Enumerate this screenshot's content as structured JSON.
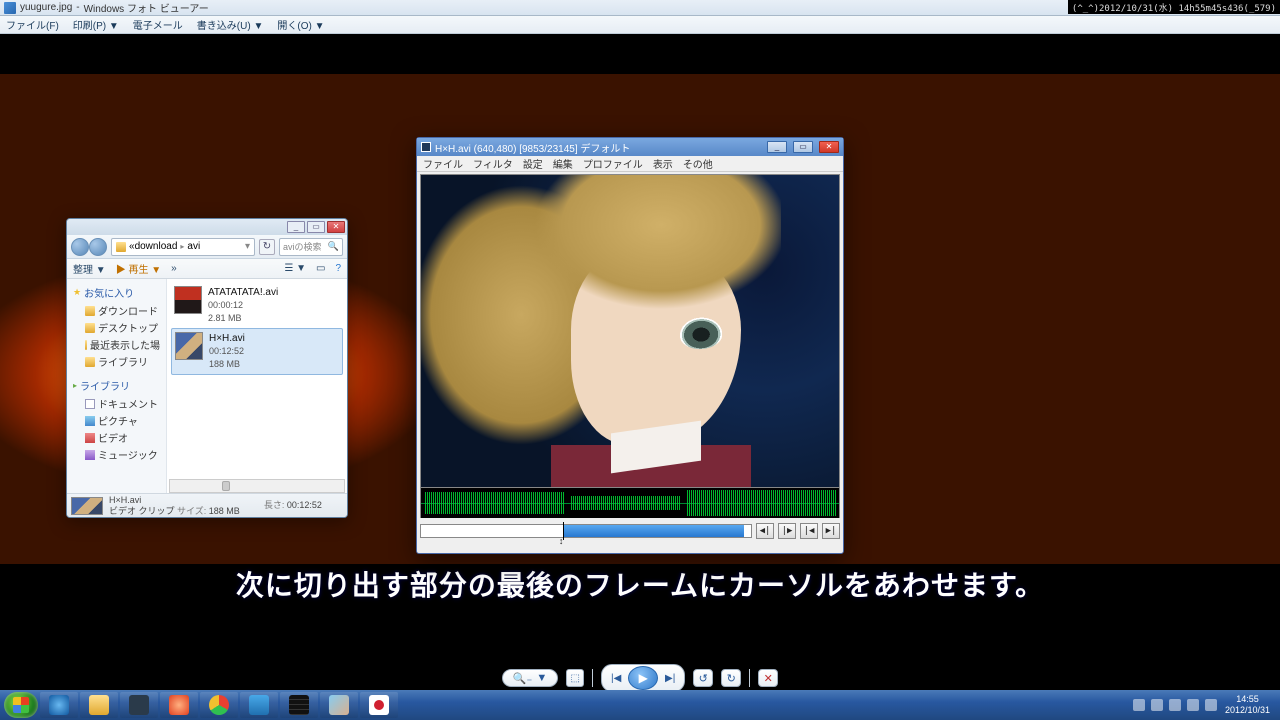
{
  "photoViewer": {
    "fileName": "yuugure.jpg",
    "appName": "Windows フォト ビューアー",
    "titleSep": " - ",
    "menu": {
      "file": "ファイル(F)",
      "print": "印刷(P)  ▼",
      "email": "電子メール",
      "burn": "書き込み(U)  ▼",
      "open": "開く(O)  ▼"
    },
    "controls": {
      "zoomOut": "🔍₋",
      "zoomDown": "▼",
      "fit": "⬚",
      "prev": "|◀",
      "play": "▶",
      "next": "▶|",
      "rotL": "↺",
      "rotR": "↻",
      "del": "✕"
    }
  },
  "cornerOverlay": "(^_^)2012/10/31(水) 14h55m45s436(_579)",
  "subtitle": "次に切り出す部分の最後のフレームにカーソルをあわせます。",
  "explorer": {
    "path": {
      "seg1": "download",
      "seg2": "avi"
    },
    "searchPlaceholder": "aviの検索",
    "toolbar": {
      "organize": "整理 ▼",
      "play": "▶ 再生 ▼",
      "more": "»",
      "view": "☰ ▼",
      "preview": "▭",
      "help": "?"
    },
    "sidebar": {
      "favorites": "お気に入り",
      "favItems": [
        "ダウンロード",
        "デスクトップ",
        "最近表示した場",
        "ライブラリ"
      ],
      "libraries": "ライブラリ",
      "libItems": [
        "ドキュメント",
        "ピクチャ",
        "ビデオ",
        "ミュージック"
      ]
    },
    "files": [
      {
        "name": "ATATATATA!.avi",
        "dur": "00:00:12",
        "size": "2.81 MB"
      },
      {
        "name": "H×H.avi",
        "dur": "00:12:52",
        "size": "188 MB"
      }
    ],
    "status": {
      "name": "H×H.avi",
      "lenLabel": "長さ:",
      "len": "00:12:52",
      "typeLabel": "ビデオ クリップ",
      "sizeLabel": "サイズ:",
      "size": "188 MB"
    }
  },
  "editor": {
    "title": "H×H.avi  (640,480)  [9853/23145]  デフォルト",
    "menu": [
      "ファイル",
      "フィルタ",
      "設定",
      "編集",
      "プロファイル",
      "表示",
      "その他"
    ],
    "btns": {
      "prevFrame": "◀|",
      "nextFrame": "|▶",
      "markIn": "|◀",
      "markOut": "▶|"
    }
  },
  "taskbar": {
    "time": "14:55",
    "date": "2012/10/31"
  }
}
